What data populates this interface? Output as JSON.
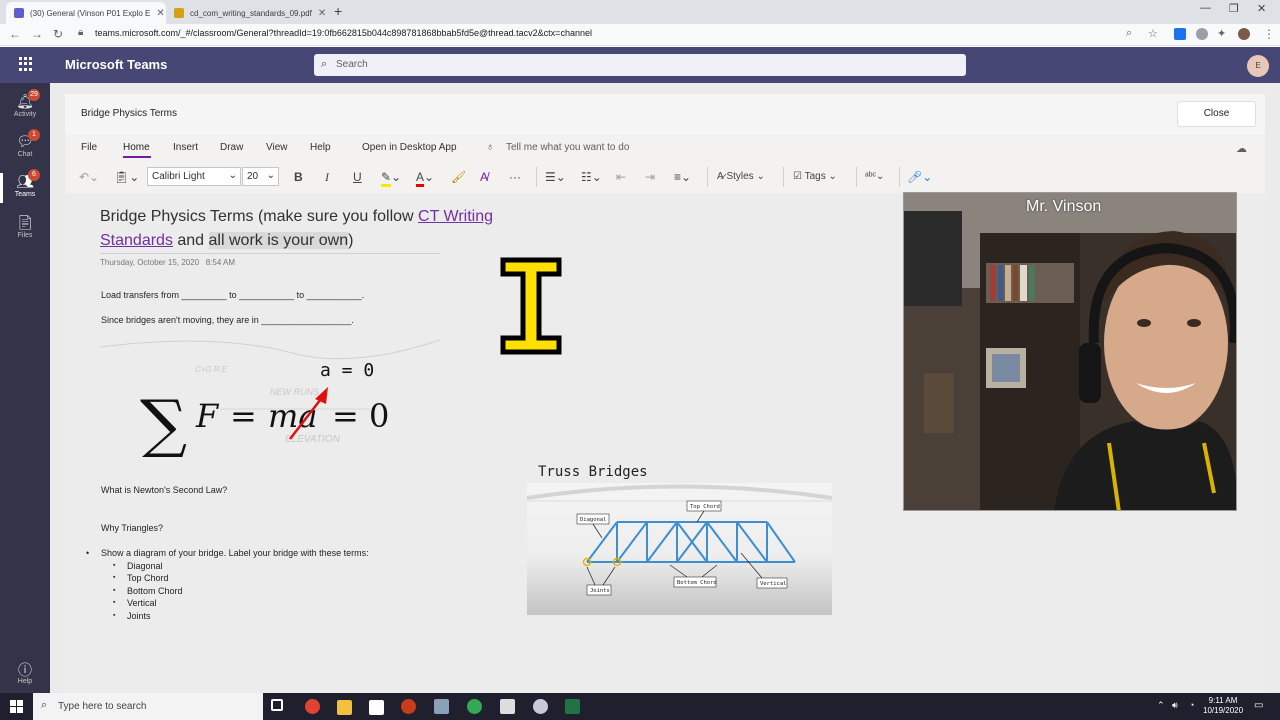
{
  "browser": {
    "tabs": [
      {
        "title": "(30) General (Vinson P01 Explo E",
        "active": true
      },
      {
        "title": "cd_com_writing_standards_09.pdf",
        "active": false
      }
    ],
    "url": "teams.microsoft.com/_#/classroom/General?threadId=19:0fb662815b044c898781868bbab5fd5e@thread.tacv2&ctx=channel"
  },
  "teams": {
    "app_title": "Microsoft Teams",
    "search_placeholder": "Search",
    "avatar_initial": "E",
    "rail": [
      {
        "label": "Activity",
        "badge": "29"
      },
      {
        "label": "Chat",
        "badge": "1"
      },
      {
        "label": "Teams",
        "badge": "6"
      },
      {
        "label": "Files",
        "badge": ""
      },
      {
        "label": "Help",
        "badge": ""
      }
    ]
  },
  "notebook": {
    "title": "Bridge Physics Terms",
    "close_label": "Close",
    "menu": [
      "File",
      "Home",
      "Insert",
      "Draw",
      "View",
      "Help",
      "Open in Desktop App"
    ],
    "tell_me": "Tell me what you want to do",
    "font_name": "Calibri Light",
    "font_size": "20",
    "styles_label": "Styles",
    "tags_label": "Tags"
  },
  "page": {
    "heading_part1": "Bridge Physics Terms (make sure you follow ",
    "heading_link": "CT Writing Standards",
    "heading_part2": " and ",
    "heading_highlight": "all work is your own",
    "heading_part3": ")",
    "date": "Thursday, October 15, 2020",
    "time": "8:54 AM",
    "line1": "Load transfers from _________ to ___________ to ___________.",
    "line2": "Since bridges aren't moving, they are in __________________.",
    "formula_top": "a = 0",
    "question1": "What is Newton's Second Law?",
    "question2": "Why Triangles?",
    "bullet_main": "Show a diagram of your bridge. Label your bridge with these terms:",
    "terms": [
      "Diagonal",
      "Top Chord",
      "Bottom Chord",
      "Vertical",
      "Joints"
    ],
    "truss_title": "Truss Bridges",
    "truss_labels": {
      "diagonal": "Diagonal",
      "top": "Top Chord",
      "bottom": "Bottom Chord",
      "vertical": "Vertical",
      "joints": "Joints"
    }
  },
  "video": {
    "name": "Mr. Vinson"
  },
  "taskbar": {
    "search_placeholder": "Type here to search",
    "time": "9:11 AM",
    "date": "10/19/2020"
  }
}
